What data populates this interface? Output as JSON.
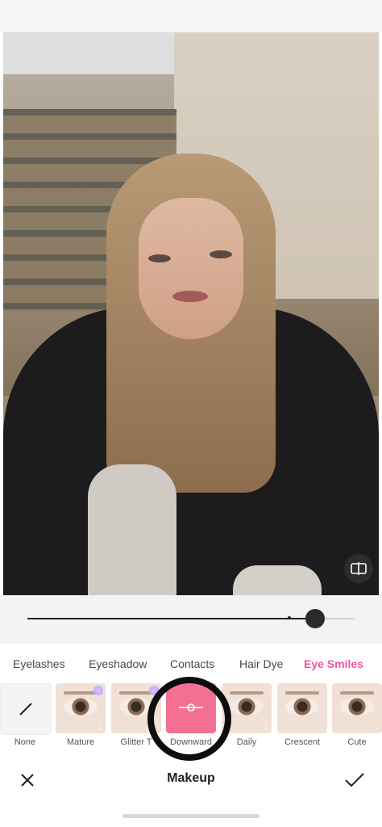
{
  "slider": {
    "value": 0.88
  },
  "tabs": [
    {
      "label": "Eyelashes"
    },
    {
      "label": "Eyeshadow"
    },
    {
      "label": "Contacts"
    },
    {
      "label": "Hair Dye"
    },
    {
      "label": "Eye Smiles",
      "active": true
    }
  ],
  "styles": [
    {
      "label": "None",
      "icon": "slash-icon"
    },
    {
      "label": "Mature"
    },
    {
      "label": "Glitter T"
    },
    {
      "label": "Downward",
      "selected": true
    },
    {
      "label": "Daily"
    },
    {
      "label": "Crescent"
    },
    {
      "label": "Cute"
    }
  ],
  "footer": {
    "title": "Makeup"
  },
  "colors": {
    "accent": "#f0559c",
    "selected_tile": "#f47092"
  },
  "icons": {
    "compare": "compare-icon",
    "close": "close-icon",
    "confirm": "check-icon",
    "download": "download-arrow-icon"
  }
}
